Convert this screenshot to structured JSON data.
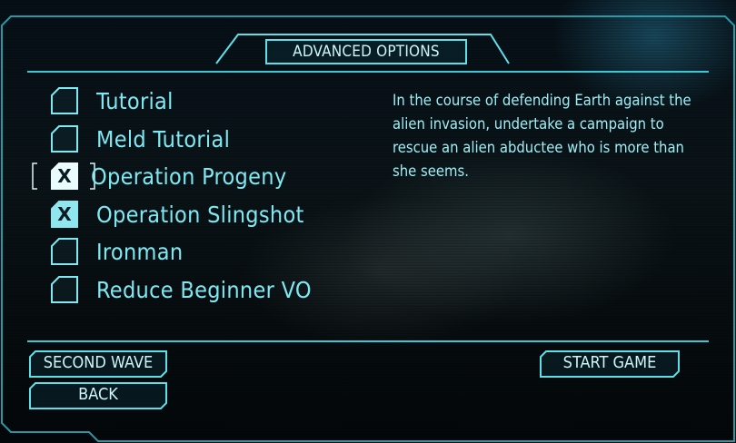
{
  "screen": {
    "title": "ADVANCED OPTIONS"
  },
  "options": [
    {
      "label": "Tutorial",
      "checked": false,
      "focused": false
    },
    {
      "label": "Meld Tutorial",
      "checked": false,
      "focused": false
    },
    {
      "label": "Operation Progeny",
      "checked": true,
      "focused": true
    },
    {
      "label": "Operation Slingshot",
      "checked": true,
      "focused": false
    },
    {
      "label": "Ironman",
      "checked": false,
      "focused": false
    },
    {
      "label": "Reduce Beginner VO",
      "checked": false,
      "focused": false
    }
  ],
  "check_mark": "X",
  "description": "In the course of defending Earth against the alien invasion, undertake a campaign to rescue an alien abductee who is more than she seems.",
  "buttons": {
    "second_wave": "SECOND WAVE",
    "back": "BACK",
    "start_game": "START GAME"
  },
  "colors": {
    "accent": "#5ee0ea",
    "label": "#7fe9f3",
    "checked_fill": "#c8f5fa"
  }
}
